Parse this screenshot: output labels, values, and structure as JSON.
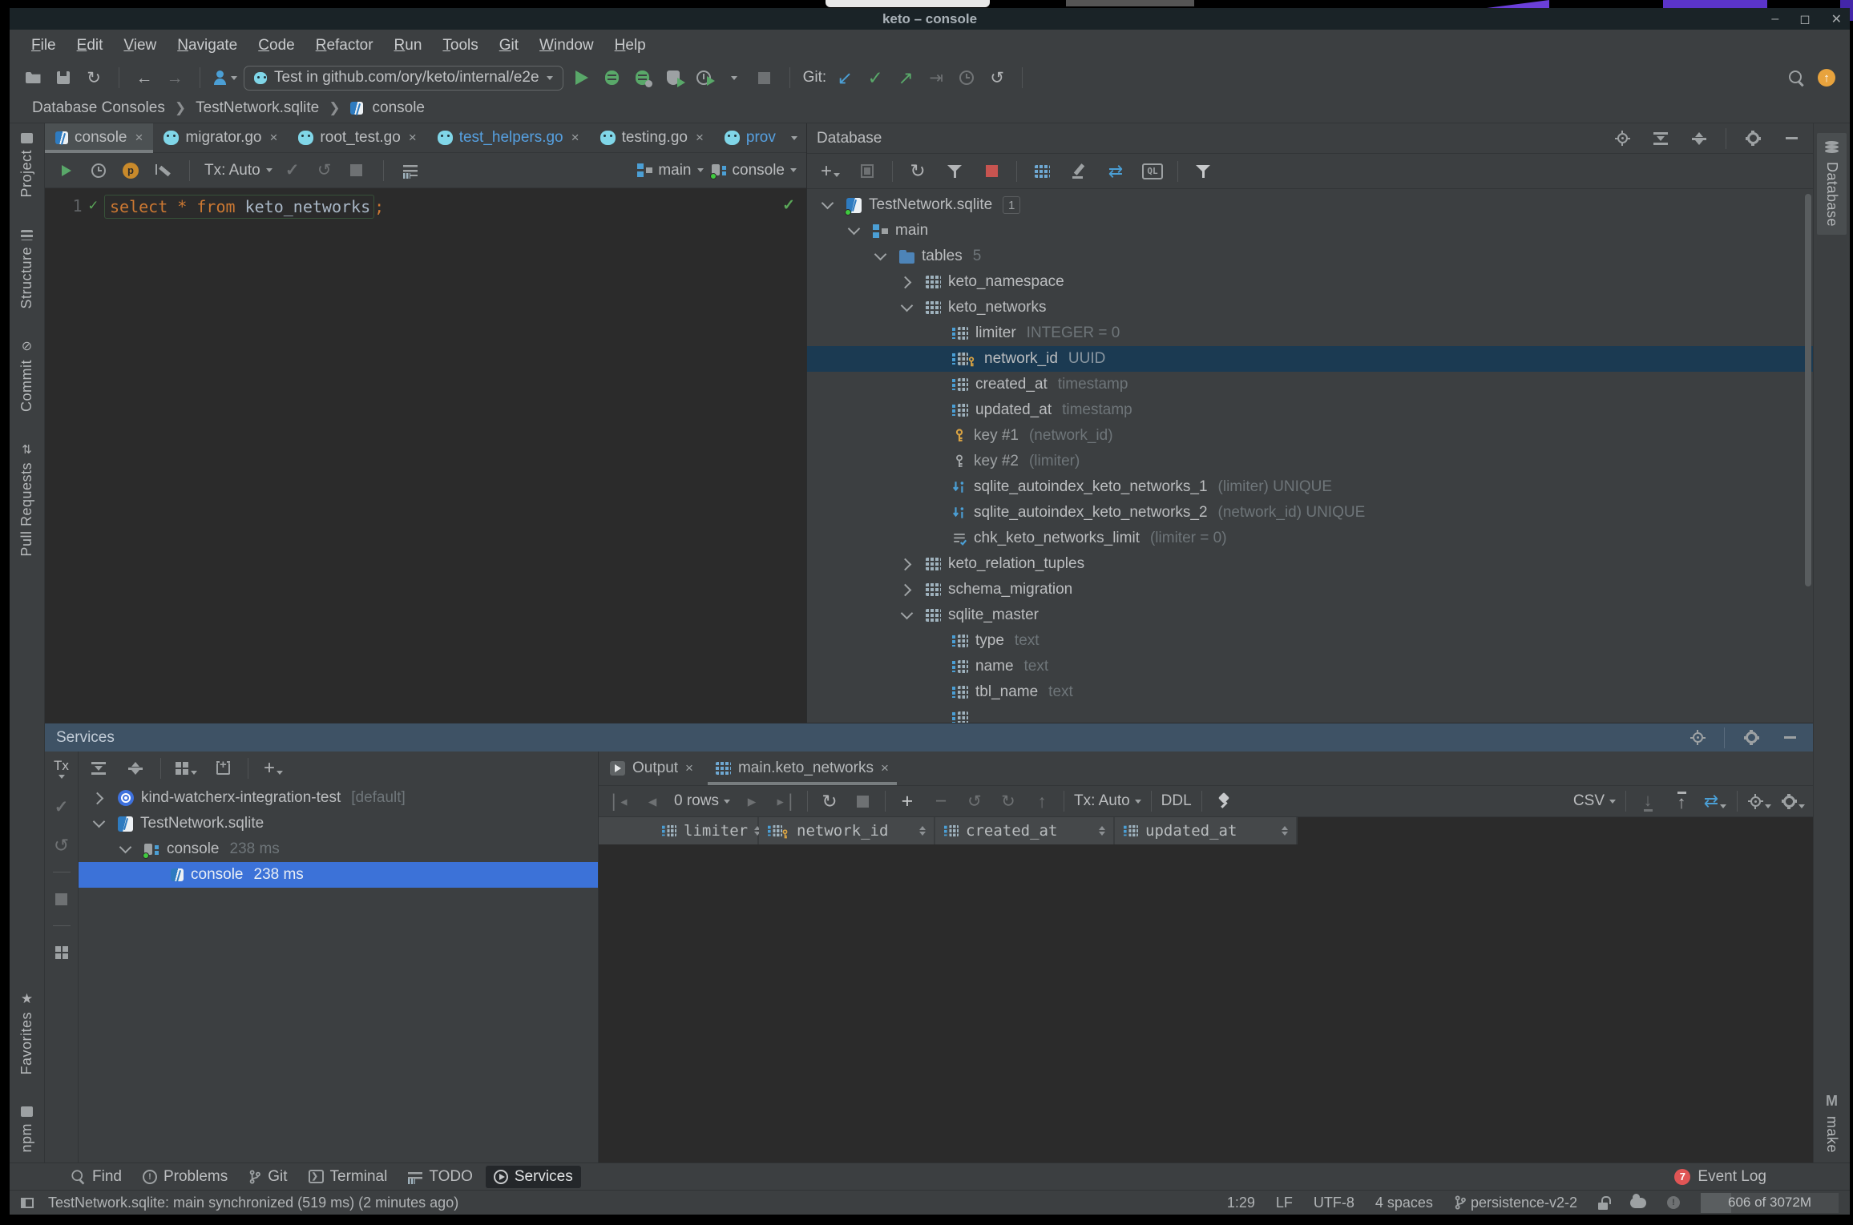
{
  "window": {
    "title": "keto – console",
    "controls": {
      "minimize": "–",
      "maximize": "◻",
      "close": "✕"
    }
  },
  "artifacts": {},
  "menu": {
    "items": [
      "File",
      "Edit",
      "View",
      "Navigate",
      "Code",
      "Refactor",
      "Run",
      "Tools",
      "Git",
      "Window",
      "Help"
    ]
  },
  "toolbar": {
    "run_config": "Test in github.com/ory/keto/internal/e2e",
    "git_label": "Git:"
  },
  "breadcrumb": {
    "items": [
      "Database Consoles",
      "TestNetwork.sqlite",
      "console"
    ]
  },
  "tabs": [
    {
      "label": "console"
    },
    {
      "label": "migrator.go"
    },
    {
      "label": "root_test.go"
    },
    {
      "label": "test_helpers.go"
    },
    {
      "label": "testing.go"
    },
    {
      "label": "prov"
    }
  ],
  "editor": {
    "toolbar": {
      "tx": "Tx: Auto",
      "schema": "main",
      "session": "console",
      "plan_letter": "p"
    },
    "line_number": "1",
    "sql": {
      "keywords": "select * from",
      "identifier": "keto_networks",
      "terminator": ";"
    }
  },
  "db": {
    "title": "Database",
    "icons": {
      "ql": "QL"
    },
    "tree": [
      {
        "label": "TestNetwork.sqlite",
        "badge": "1"
      },
      {
        "label": "main"
      },
      {
        "label": "tables",
        "meta": "5"
      },
      {
        "label": "keto_namespace"
      },
      {
        "label": "keto_networks"
      },
      {
        "label": "limiter",
        "meta": "INTEGER = 0"
      },
      {
        "label": "network_id",
        "meta": "UUID"
      },
      {
        "label": "created_at",
        "meta": "timestamp"
      },
      {
        "label": "updated_at",
        "meta": "timestamp"
      },
      {
        "label": "key #1",
        "meta": "(network_id)"
      },
      {
        "label": "key #2",
        "meta": "(limiter)"
      },
      {
        "label": "sqlite_autoindex_keto_networks_1",
        "meta": "(limiter) UNIQUE"
      },
      {
        "label": "sqlite_autoindex_keto_networks_2",
        "meta": "(network_id) UNIQUE"
      },
      {
        "label": "chk_keto_networks_limit",
        "meta": "(limiter = 0)"
      },
      {
        "label": "keto_relation_tuples"
      },
      {
        "label": "schema_migration"
      },
      {
        "label": "sqlite_master"
      },
      {
        "label": "type",
        "meta": "text"
      },
      {
        "label": "name",
        "meta": "text"
      },
      {
        "label": "tbl_name",
        "meta": "text"
      }
    ]
  },
  "services": {
    "title": "Services",
    "tx": "Tx",
    "tree": [
      {
        "label": "kind-watcherx-integration-test",
        "meta": "[default]"
      },
      {
        "label": "TestNetwork.sqlite"
      },
      {
        "label": "console",
        "meta": "238 ms"
      },
      {
        "label": "console",
        "meta": "238 ms"
      }
    ],
    "tabs": {
      "output": "Output",
      "grid": "main.keto_networks"
    },
    "grid": {
      "rows": "0 rows",
      "tx": "Tx: Auto",
      "ddl": "DDL",
      "csv": "CSV",
      "columns": [
        "limiter",
        "network_id",
        "created_at",
        "updated_at"
      ]
    }
  },
  "bottom": {
    "tools": [
      "Find",
      "Problems",
      "Git",
      "Terminal",
      "TODO",
      "Services"
    ],
    "event_badge": "7",
    "event_log": "Event Log"
  },
  "status": {
    "message": "TestNetwork.sqlite: main synchronized (519 ms) (2 minutes ago)",
    "position": "1:29",
    "line_ending": "LF",
    "encoding": "UTF-8",
    "indent": "4 spaces",
    "branch": "persistence-v2-2",
    "memory": "606 of 3072M"
  },
  "left_bar": {
    "top": [
      "Project",
      "Structure",
      "Commit",
      "Pull Requests"
    ],
    "bottom": [
      "Favorites",
      "npm"
    ]
  },
  "right_bar": {
    "top": [
      "Database"
    ],
    "bottom": [
      "make"
    ],
    "make_icon": "M"
  }
}
